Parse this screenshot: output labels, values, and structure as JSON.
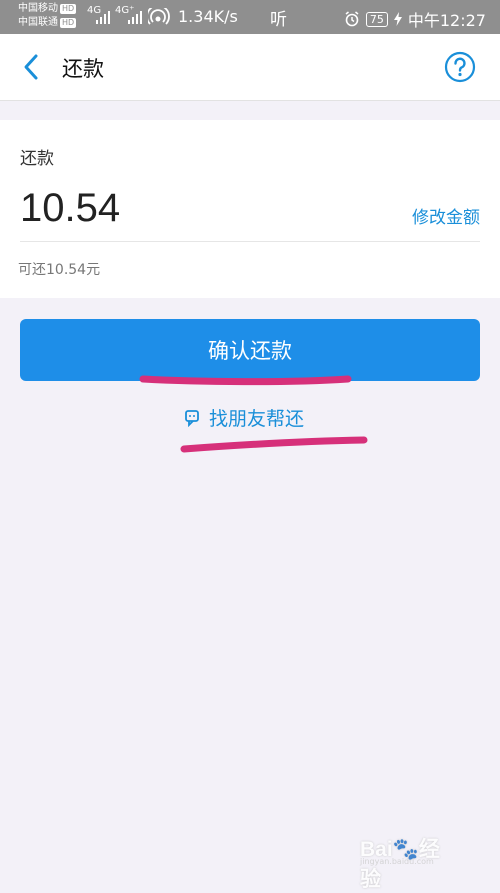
{
  "status_bar": {
    "carrier1": "中国移动",
    "carrier2": "中国联通",
    "hd": "HD",
    "net1": "4G",
    "net2": "4G⁺",
    "speed": "1.34K/s",
    "ting": "听",
    "battery": "75",
    "time": "中午12:27"
  },
  "nav": {
    "title": "还款",
    "back_icon": "chevron-left-icon",
    "help_icon": "question-circle-icon"
  },
  "repay": {
    "label": "还款",
    "amount": "10.54",
    "modify_link": "修改金额",
    "available": "可还10.54元"
  },
  "actions": {
    "confirm": "确认还款",
    "friend_help": "找朋友帮还",
    "friend_icon": "chat-bubble-icon"
  },
  "colors": {
    "accent": "#1e8ee8",
    "link": "#1a8fd9",
    "annotation": "#d6307a"
  },
  "watermark": {
    "brand": "Bai",
    "brand_suffix": "经验",
    "sub": "jingyan.baidu.com"
  }
}
